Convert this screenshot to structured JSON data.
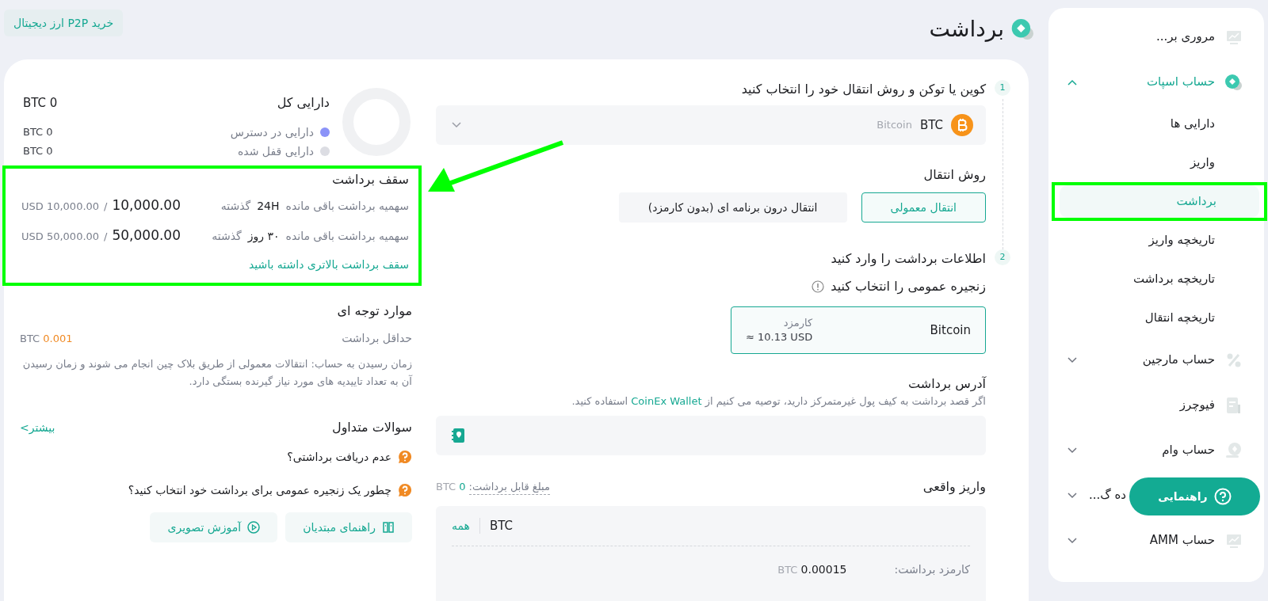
{
  "top_button": "خرید P2P ارز دیجیتال",
  "page_title": "برداشت",
  "sidebar": {
    "items": [
      {
        "label": "مروری بر...",
        "kind": "link",
        "selected": false
      },
      {
        "label": "حساب اسپات",
        "kind": "group",
        "expanded": true,
        "selected": true,
        "children": [
          {
            "label": "دارایی ها",
            "selected": false
          },
          {
            "label": "واریز",
            "selected": false
          },
          {
            "label": "برداشت",
            "selected": true,
            "annotated": true
          },
          {
            "label": "تاریخچه واریز",
            "selected": false
          },
          {
            "label": "تاریخچه برداشت",
            "selected": false
          },
          {
            "label": "تاریخچه انتقال",
            "selected": false
          }
        ]
      },
      {
        "label": "حساب مارجین",
        "kind": "group",
        "expanded": false,
        "selected": false
      },
      {
        "label": "فیوچرز",
        "kind": "link",
        "selected": false
      },
      {
        "label": "حساب وام",
        "kind": "group",
        "expanded": false,
        "selected": false
      },
      {
        "label": "ده گ...",
        "kind": "group",
        "expanded": false,
        "selected": false,
        "covered": true
      },
      {
        "label": "حساب AMM",
        "kind": "group",
        "expanded": false,
        "selected": false
      }
    ]
  },
  "steps": [
    {
      "number": "1",
      "title": "کوین یا توکن و روش انتقال خود را انتخاب کنید"
    },
    {
      "number": "2",
      "title": "اطلاعات برداشت را وارد کنید"
    }
  ],
  "coin_select": {
    "symbol": "BTC",
    "name": "Bitcoin"
  },
  "transfer_method": {
    "label": "روش انتقال",
    "options": [
      {
        "label": "انتقال معمولی",
        "selected": true
      },
      {
        "label": "انتقال درون برنامه ای (بدون کارمزد)",
        "selected": false
      }
    ]
  },
  "chain": {
    "label": "زنجیره عمومی را انتخاب کنید",
    "options": [
      {
        "name": "Bitcoin",
        "fee_label": "کارمزد",
        "fee": "≈ 10.13 USD",
        "selected": true
      }
    ]
  },
  "address": {
    "label": "آدرس برداشت",
    "hint_before": "اگر قصد برداشت به کیف پول غیرمتمرکز دارید، توصیه می کنیم از",
    "link": "CoinEx Wallet",
    "hint_after": "استفاده کنید."
  },
  "amount": {
    "label": "واریز واقعی",
    "available_label": "مبلغ قابل برداشت:",
    "available_value": "0",
    "available_unit": "BTC",
    "unit": "BTC",
    "all": "همه",
    "fee_label": "کارمزد برداشت:",
    "fee_value": "0.00015",
    "fee_unit": "BTC"
  },
  "assets": {
    "title": "دارایی کل",
    "total_value": "0",
    "total_unit": "BTC",
    "rows": [
      {
        "label": "دارایی در دسترس",
        "value": "0",
        "unit": "BTC",
        "color": "#8b93f8"
      },
      {
        "label": "دارایی قفل شده",
        "value": "0",
        "unit": "BTC",
        "color": "#dcdde3"
      }
    ]
  },
  "limits": {
    "title": "سقف برداشت",
    "annotated": true,
    "rows": [
      {
        "label": "سهمیه برداشت باقی مانده",
        "period": "24H",
        "suffix": "گذشته",
        "remaining": "10,000.00",
        "separator": "/",
        "total": "10,000.00",
        "unit": "USD"
      },
      {
        "label": "سهمیه برداشت باقی مانده",
        "period": "۳۰ روز",
        "suffix": "گذشته",
        "remaining": "50,000.00",
        "separator": "/",
        "total": "50,000.00",
        "unit": "USD"
      }
    ],
    "link": "سقف برداشت بالاتری داشته باشید"
  },
  "notes": {
    "title": "موارد توجه ای",
    "min_label": "حداقل برداشت",
    "min_value": "0.001",
    "min_unit": "BTC",
    "text": "زمان رسیدن به حساب: انتقالات معمولی از طریق بلاک چین انجام می شوند و زمان رسیدن آن به تعداد تاییدیه های مورد نیاز گیرنده بستگی دارد."
  },
  "faq": {
    "title": "سوالات متداول",
    "more": "بیشتر>",
    "questions": [
      "عدم دریافت برداشتی؟",
      "چطور یک زنجیره عمومی برای برداشت خود انتخاب کنید؟"
    ],
    "buttons": [
      {
        "label": "راهنمای مبتدیان",
        "kind": "book"
      },
      {
        "label": "آموزش تصویری",
        "kind": "video"
      }
    ]
  },
  "help_button": "راهنمایی"
}
